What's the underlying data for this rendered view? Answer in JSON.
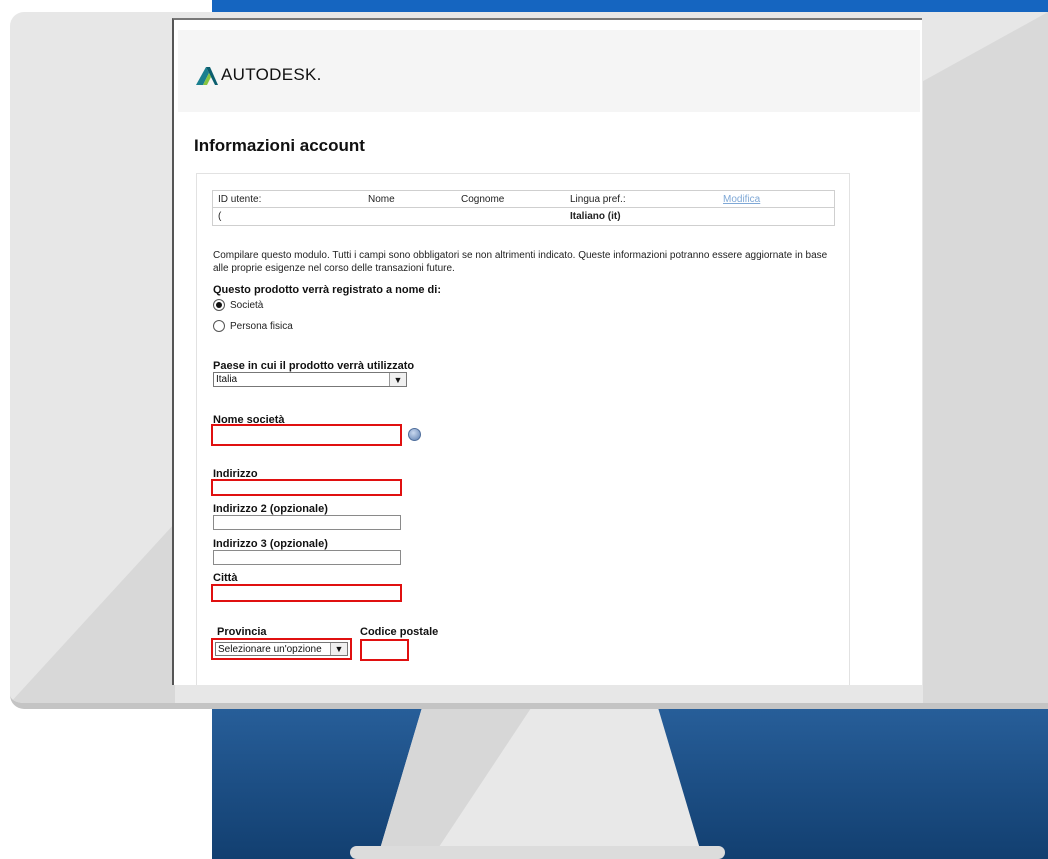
{
  "logo": {
    "text": "AUTODESK."
  },
  "page": {
    "title": "Informazioni account"
  },
  "account_table": {
    "headers": {
      "user_id": "ID utente:",
      "first_name": "Nome",
      "last_name": "Cognome",
      "language": "Lingua pref.:",
      "edit": "Modifica"
    },
    "values": {
      "user_id": "(",
      "language": "Italiano (it)"
    }
  },
  "form": {
    "intro": "Compilare questo modulo. Tutti i campi sono obbligatori se non altrimenti indicato. Queste informazioni potranno essere aggiornate in base alle proprie esigenze nel corso delle transazioni future.",
    "registrant_label": "Questo prodotto verrà registrato a nome di:",
    "registrant_options": [
      "Società",
      "Persona fisica"
    ],
    "registrant_selected": "Società",
    "country_label": "Paese in cui il prodotto verrà utilizzato",
    "country_value": "Italia",
    "company_label": "Nome società",
    "address_label": "Indirizzo",
    "address2_label": "Indirizzo 2 (opzionale)",
    "address3_label": "Indirizzo 3 (opzionale)",
    "city_label": "Città",
    "province_label": "Provincia",
    "province_value": "Selezionare un'opzione",
    "postal_label": "Codice postale"
  },
  "colors": {
    "required_border": "#e01010",
    "link": "#7fa8d6",
    "top_bar": "#1565c0",
    "stand_background": "#1f4e80"
  },
  "icons": [
    "autodesk-logo-icon",
    "help-icon",
    "chevron-down-icon"
  ]
}
